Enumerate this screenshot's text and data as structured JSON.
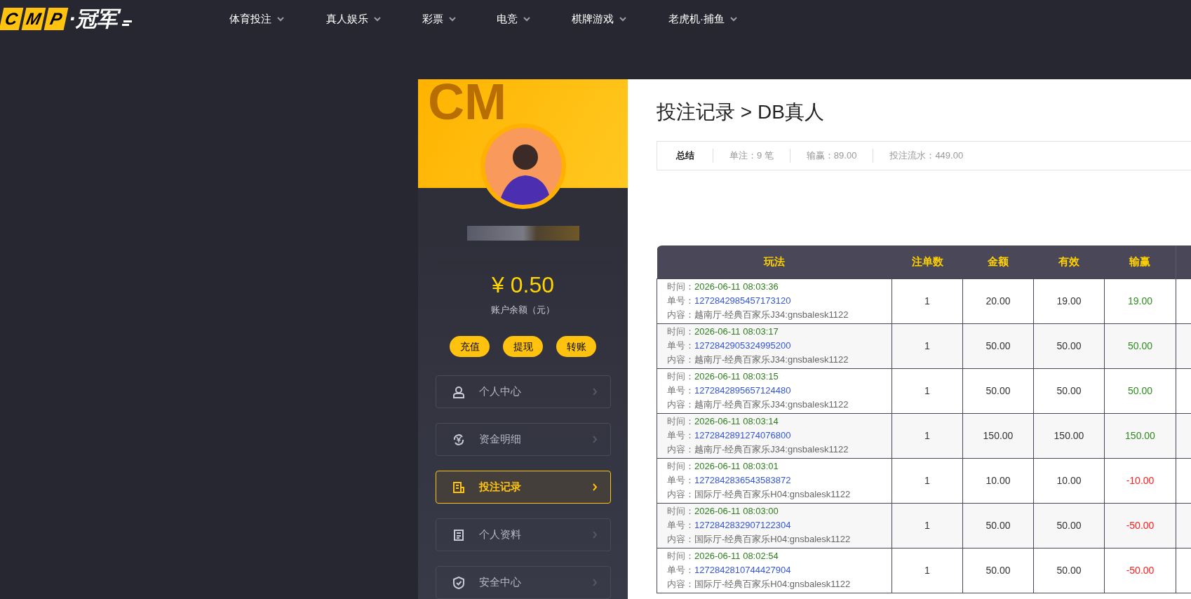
{
  "logo": {
    "boxes": [
      "C",
      "M",
      "P"
    ],
    "text": "·冠军"
  },
  "nav": [
    {
      "label": "体育投注"
    },
    {
      "label": "真人娱乐"
    },
    {
      "label": "彩票"
    },
    {
      "label": "电竞"
    },
    {
      "label": "棋牌游戏"
    },
    {
      "label": "老虎机·捕鱼"
    }
  ],
  "profile": {
    "banner_watermark": "CM",
    "balance": "¥ 0.50",
    "balance_label": "账户余额（元）",
    "actions": [
      "充值",
      "提现",
      "转账"
    ]
  },
  "menu": [
    {
      "label": "个人中心",
      "kind": "user",
      "selected": false
    },
    {
      "label": "资金明细",
      "kind": "money",
      "selected": false
    },
    {
      "label": "投注记录",
      "kind": "bets",
      "selected": true
    },
    {
      "label": "个人资料",
      "kind": "profile",
      "selected": false
    },
    {
      "label": "安全中心",
      "kind": "security",
      "selected": false
    }
  ],
  "page_title": "投注记录 > DB真人",
  "summary": {
    "label": "总结",
    "items": [
      "单注：9 笔",
      "输赢：89.00",
      "投注流水：449.00"
    ]
  },
  "table": {
    "columns": [
      "玩法",
      "注单数",
      "金额",
      "有效",
      "输赢"
    ],
    "rows": [
      {
        "time_label": "时间：",
        "time": "2026-06-11 08:03:36",
        "no_label": "单号：",
        "no": "1272842985457173120",
        "content_label": "内容：",
        "content": "越南厅-经典百家乐J34:gnsbalesk1122",
        "count": "1",
        "amount": "20.00",
        "valid": "19.00",
        "result": "19.00",
        "color": "#2e8b1e"
      },
      {
        "time_label": "时间：",
        "time": "2026-06-11 08:03:17",
        "no_label": "单号：",
        "no": "1272842905324995200",
        "content_label": "内容：",
        "content": "越南厅-经典百家乐J34:gnsbalesk1122",
        "count": "1",
        "amount": "50.00",
        "valid": "50.00",
        "result": "50.00",
        "color": "#2e8b1e"
      },
      {
        "time_label": "时间：",
        "time": "2026-06-11 08:03:15",
        "no_label": "单号：",
        "no": "1272842895657124480",
        "content_label": "内容：",
        "content": "越南厅-经典百家乐J34:gnsbalesk1122",
        "count": "1",
        "amount": "50.00",
        "valid": "50.00",
        "result": "50.00",
        "color": "#2e8b1e"
      },
      {
        "time_label": "时间：",
        "time": "2026-06-11 08:03:14",
        "no_label": "单号：",
        "no": "1272842891274076800",
        "content_label": "内容：",
        "content": "越南厅-经典百家乐J34:gnsbalesk1122",
        "count": "1",
        "amount": "150.00",
        "valid": "150.00",
        "result": "150.00",
        "color": "#2e8b1e"
      },
      {
        "time_label": "时间：",
        "time": "2026-06-11 08:03:01",
        "no_label": "单号：",
        "no": "1272842836543583872",
        "content_label": "内容：",
        "content": "国际厅-经典百家乐H04:gnsbalesk1122",
        "count": "1",
        "amount": "10.00",
        "valid": "10.00",
        "result": "-10.00",
        "color": "#ff2020"
      },
      {
        "time_label": "时间：",
        "time": "2026-06-11 08:03:00",
        "no_label": "单号：",
        "no": "1272842832907122304",
        "content_label": "内容：",
        "content": "国际厅-经典百家乐H04:gnsbalesk1122",
        "count": "1",
        "amount": "50.00",
        "valid": "50.00",
        "result": "-50.00",
        "color": "#ff2020"
      },
      {
        "time_label": "时间：",
        "time": "2026-06-11 08:02:54",
        "no_label": "单号：",
        "no": "1272842810744427904",
        "content_label": "内容：",
        "content": "国际厅-经典百家乐H04:gnsbalesk1122",
        "count": "1",
        "amount": "50.00",
        "valid": "50.00",
        "result": "-50.00",
        "color": "#ff2020"
      }
    ]
  }
}
